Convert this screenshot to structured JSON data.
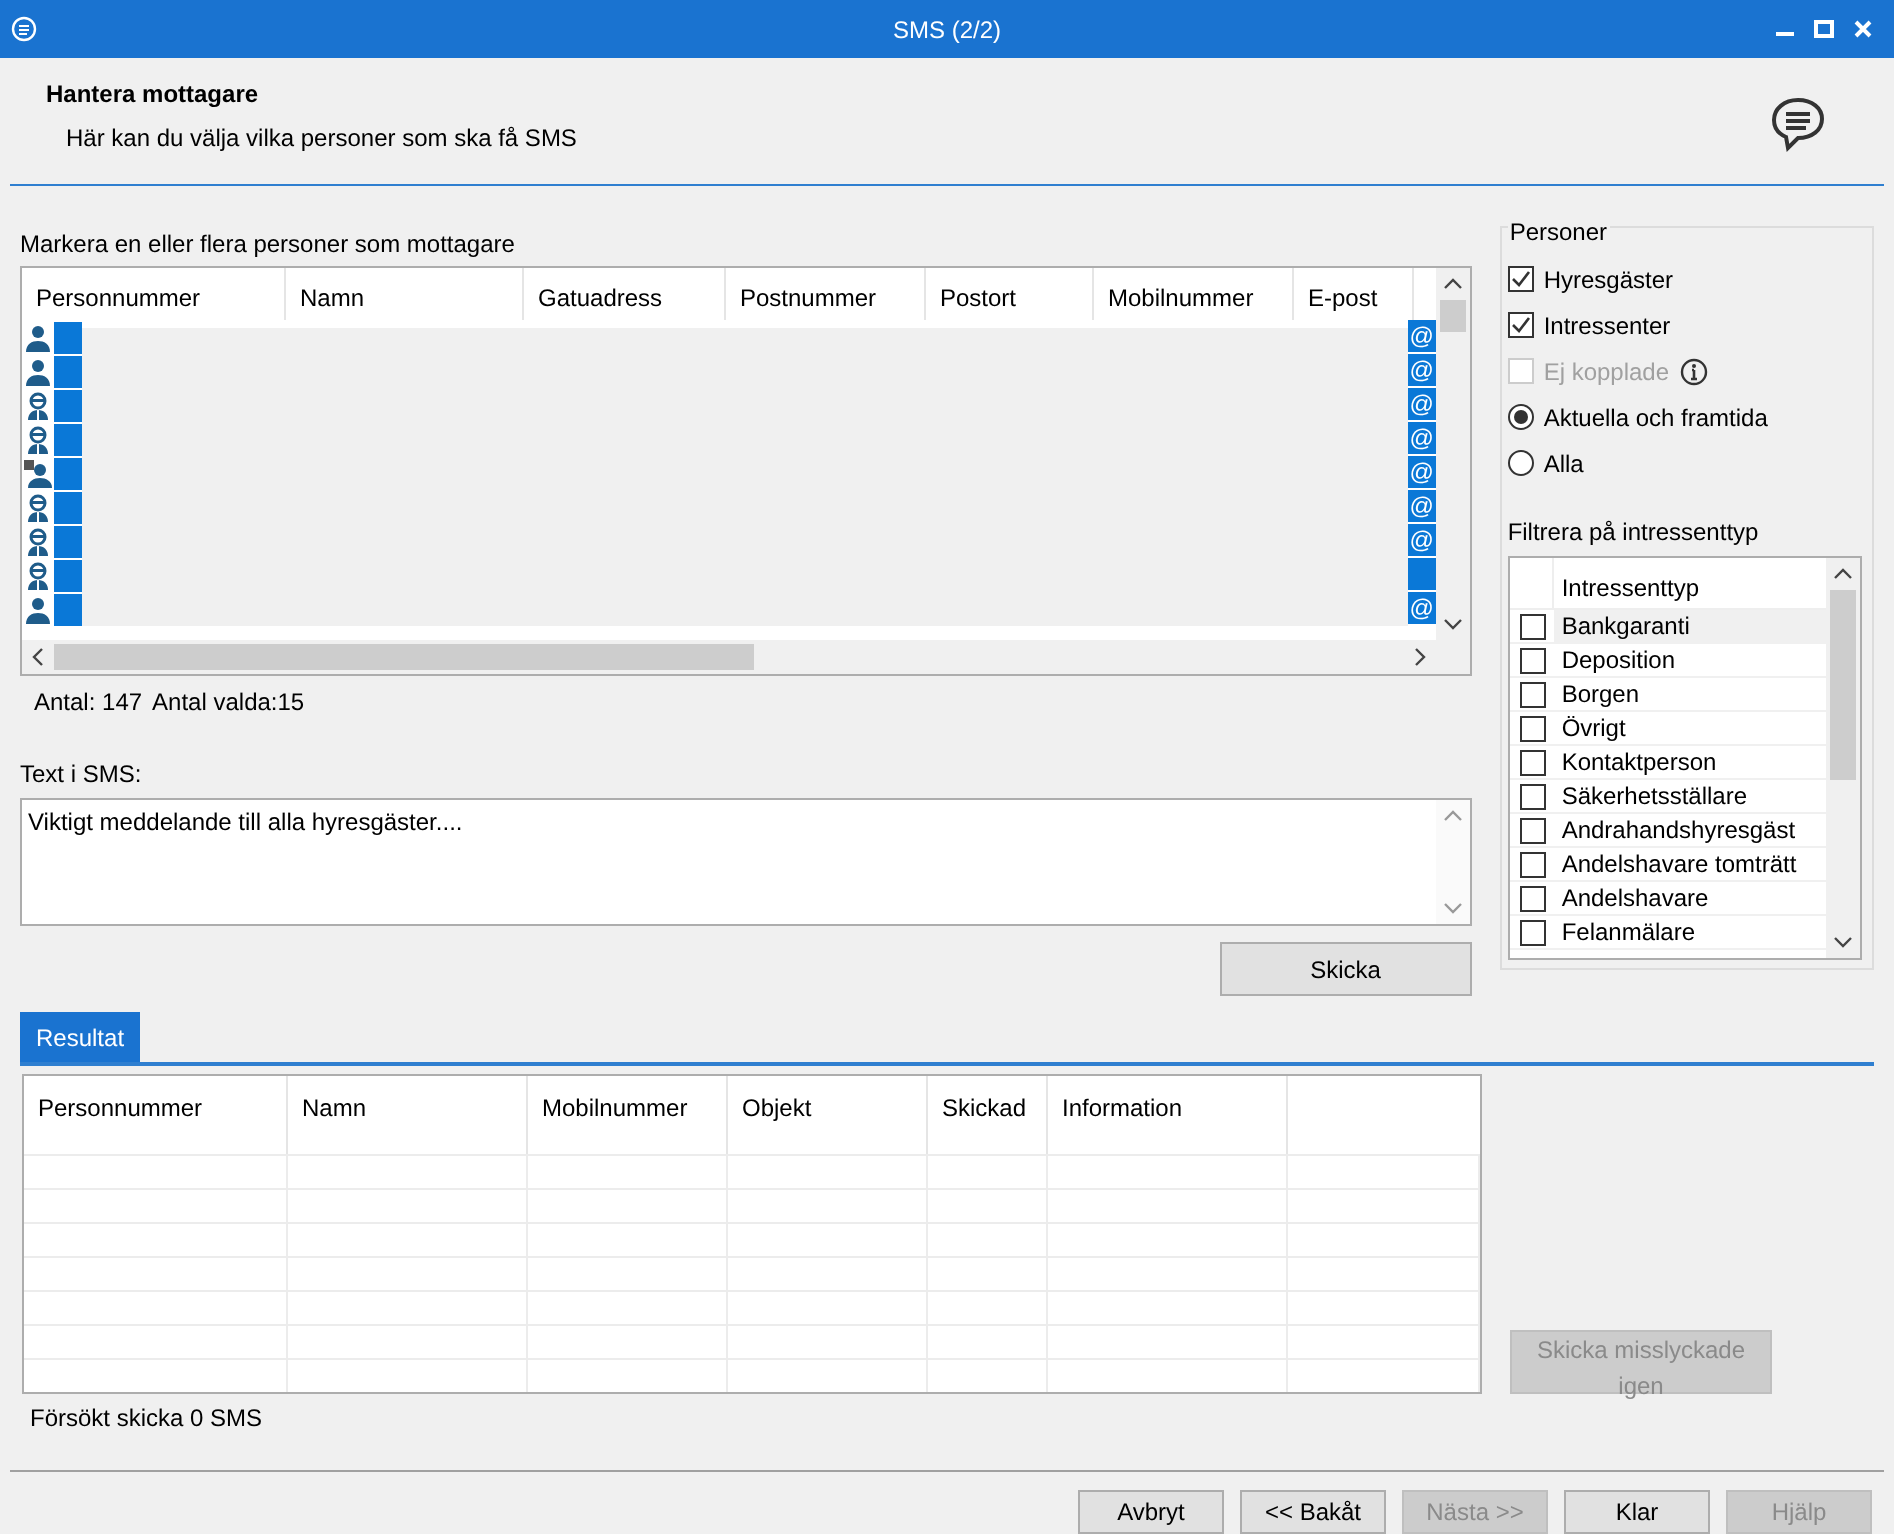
{
  "window": {
    "title": "SMS (2/2)"
  },
  "header": {
    "title": "Hantera mottagare",
    "subtitle": "Här kan du välja vilka personer som ska få SMS"
  },
  "recipients": {
    "label": "Markera en eller flera personer som mottagare",
    "columns": [
      "Personnummer",
      "Namn",
      "Gatuadress",
      "Postnummer",
      "Postort",
      "Mobilnummer",
      "E-post"
    ],
    "rows": [
      {
        "kind": "person",
        "selected": true,
        "email_marker": "@"
      },
      {
        "kind": "person",
        "selected": true,
        "email_marker": "@"
      },
      {
        "kind": "agent",
        "selected": true,
        "email_marker": "@"
      },
      {
        "kind": "agent",
        "selected": true,
        "email_marker": "@"
      },
      {
        "kind": "company",
        "selected": true,
        "email_marker": "@"
      },
      {
        "kind": "agent",
        "selected": true,
        "email_marker": "@"
      },
      {
        "kind": "agent",
        "selected": true,
        "email_marker": "@"
      },
      {
        "kind": "agent",
        "selected": true
      },
      {
        "kind": "person",
        "selected": true,
        "email_marker": "@"
      }
    ],
    "count": "Antal: 147",
    "selected_count": "Antal valda:15"
  },
  "sms": {
    "label": "Text i SMS:",
    "value": "Viktigt meddelande till alla hyresgäster....",
    "send_button": "Skicka"
  },
  "persons": {
    "title": "Personer",
    "options": [
      {
        "kind": "checkbox",
        "label": "Hyresgäster",
        "checked": true,
        "disabled": false,
        "info": false
      },
      {
        "kind": "checkbox",
        "label": "Intressenter",
        "checked": true,
        "disabled": false,
        "info": false
      },
      {
        "kind": "checkbox",
        "label": "Ej kopplade",
        "checked": false,
        "disabled": true,
        "info": true
      },
      {
        "kind": "radio",
        "label": "Aktuella och framtida",
        "checked": true,
        "disabled": false,
        "info": false
      },
      {
        "kind": "radio",
        "label": "Alla",
        "checked": false,
        "disabled": false,
        "info": false
      }
    ]
  },
  "filter": {
    "label": "Filtrera på intressenttyp",
    "column": "Intressenttyp",
    "items": [
      {
        "label": "Bankgaranti",
        "checked": false,
        "selected": true
      },
      {
        "label": "Deposition",
        "checked": false,
        "selected": false
      },
      {
        "label": "Borgen",
        "checked": false,
        "selected": false
      },
      {
        "label": "Övrigt",
        "checked": false,
        "selected": false
      },
      {
        "label": "Kontaktperson",
        "checked": false,
        "selected": false
      },
      {
        "label": "Säkerhetsställare",
        "checked": false,
        "selected": false
      },
      {
        "label": "Andrahandshyresgäst",
        "checked": false,
        "selected": false
      },
      {
        "label": "Andelshavare tomträtt",
        "checked": false,
        "selected": false
      },
      {
        "label": "Andelshavare",
        "checked": false,
        "selected": false
      },
      {
        "label": "Felanmälare",
        "checked": false,
        "selected": false
      }
    ]
  },
  "result": {
    "tab": {
      "label": "Resultat",
      "selected": true
    },
    "columns": [
      "Personnummer",
      "Namn",
      "Mobilnummer",
      "Objekt",
      "Skickad",
      "Information"
    ],
    "status": "Försökt skicka 0 SMS",
    "retry_button": {
      "label": "Skicka misslyckade igen",
      "disabled": true
    }
  },
  "footer_buttons": [
    {
      "label": "Avbryt",
      "disabled": false
    },
    {
      "label": "<< Bakåt",
      "disabled": false
    },
    {
      "label": "Nästa >>",
      "disabled": true
    },
    {
      "label": "Klar",
      "disabled": false
    },
    {
      "label": "Hjälp",
      "disabled": true
    }
  ]
}
